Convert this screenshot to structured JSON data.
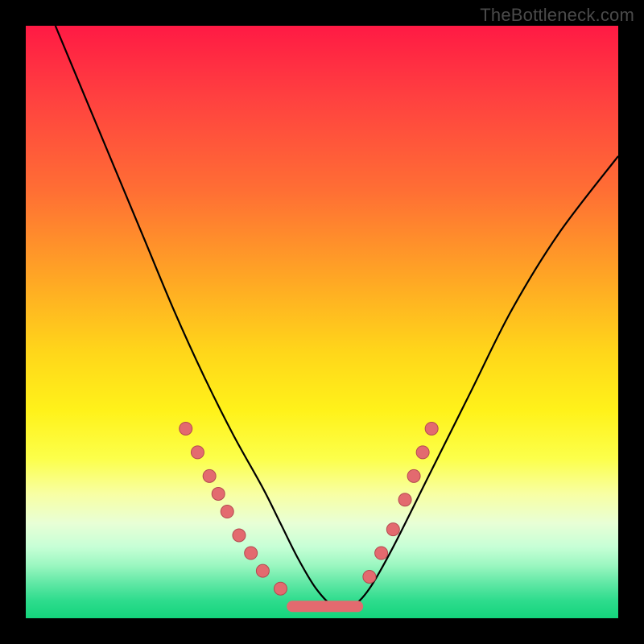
{
  "watermark": "TheBottleneck.com",
  "colors": {
    "frame": "#000000",
    "gradient_top": "#ff1a44",
    "gradient_bottom": "#14d47c",
    "curve": "#000000",
    "dot_fill": "#e36a6f",
    "dot_stroke": "#b34a50"
  },
  "chart_data": {
    "type": "line",
    "title": "",
    "xlabel": "",
    "ylabel": "",
    "xlim": [
      0,
      100
    ],
    "ylim": [
      0,
      100
    ],
    "grid": false,
    "legend": false,
    "note": "No numeric axis ticks are displayed in the image; x/y values below are estimated from pixel positions within the plot area, expressed on a 0–100 scale.",
    "series": [
      {
        "name": "bottleneck-curve",
        "x": [
          5,
          10,
          15,
          20,
          25,
          30,
          35,
          40,
          43,
          46,
          49,
          52,
          55,
          58,
          62,
          68,
          75,
          82,
          90,
          100
        ],
        "y": [
          100,
          88,
          76,
          64,
          52,
          41,
          31,
          22,
          16,
          10,
          5,
          2,
          2,
          5,
          12,
          24,
          38,
          52,
          65,
          78
        ]
      }
    ],
    "markers": {
      "name": "highlight-dots",
      "note": "Salmon dots along lower portion of both arms of the V.",
      "points": [
        {
          "x": 27,
          "y": 32
        },
        {
          "x": 29,
          "y": 28
        },
        {
          "x": 31,
          "y": 24
        },
        {
          "x": 32.5,
          "y": 21
        },
        {
          "x": 34,
          "y": 18
        },
        {
          "x": 36,
          "y": 14
        },
        {
          "x": 38,
          "y": 11
        },
        {
          "x": 40,
          "y": 8
        },
        {
          "x": 43,
          "y": 5
        },
        {
          "x": 58,
          "y": 7
        },
        {
          "x": 60,
          "y": 11
        },
        {
          "x": 62,
          "y": 15
        },
        {
          "x": 64,
          "y": 20
        },
        {
          "x": 65.5,
          "y": 24
        },
        {
          "x": 67,
          "y": 28
        },
        {
          "x": 68.5,
          "y": 32
        }
      ]
    },
    "valley_segment": {
      "name": "flat-bottom",
      "x_start": 45,
      "x_end": 56,
      "y": 2
    }
  }
}
